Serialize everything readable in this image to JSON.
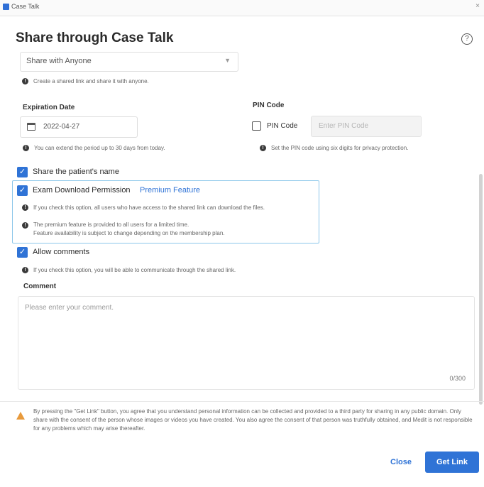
{
  "window": {
    "app_title": "Case Talk"
  },
  "dialog": {
    "title": "Share through Case Talk",
    "help_glyph": "?"
  },
  "share_mode": {
    "selected": "Share with Anyone",
    "hint": "Create a shared link and share it with anyone."
  },
  "expiration": {
    "label": "Expiration Date",
    "value": "2022-04-27",
    "hint": "You can extend the period up to 30 days from today."
  },
  "pin": {
    "label": "PIN Code",
    "checkbox_label": "PIN Code",
    "checked": false,
    "placeholder": "Enter PIN Code",
    "hint": "Set the PIN code using six digits for privacy protection."
  },
  "options": {
    "share_name": {
      "label": "Share the patient's name",
      "checked": true
    },
    "download": {
      "label": "Exam Download Permission",
      "premium": "Premium Feature",
      "checked": true,
      "hint1": "If you check this option, all users who have access to the shared link can download the files.",
      "hint2_line1": "The premium feature is provided to all users for a limited time.",
      "hint2_line2": "Feature availability is subject to change depending on the membership plan."
    },
    "comments": {
      "label": "Allow comments",
      "checked": true,
      "hint": "If you check this option, you will be able to communicate through the shared link."
    }
  },
  "comment": {
    "label": "Comment",
    "placeholder": "Please enter your comment.",
    "count": "0/300"
  },
  "disclaimer": "By pressing the \"Get Link\" button, you agree that you understand personal information can be collected and provided to a third party for sharing in any public domain. Only share with the consent of the person whose images or videos you have created. You also agree the consent of that person was truthfully obtained, and Medit is not responsible for any problems which may arise thereafter.",
  "footer": {
    "close_label": "Close",
    "get_link_label": "Get Link"
  },
  "colors": {
    "accent": "#2f73d6",
    "highlight_border": "#8cc7ea",
    "warning": "#e89a3c"
  }
}
